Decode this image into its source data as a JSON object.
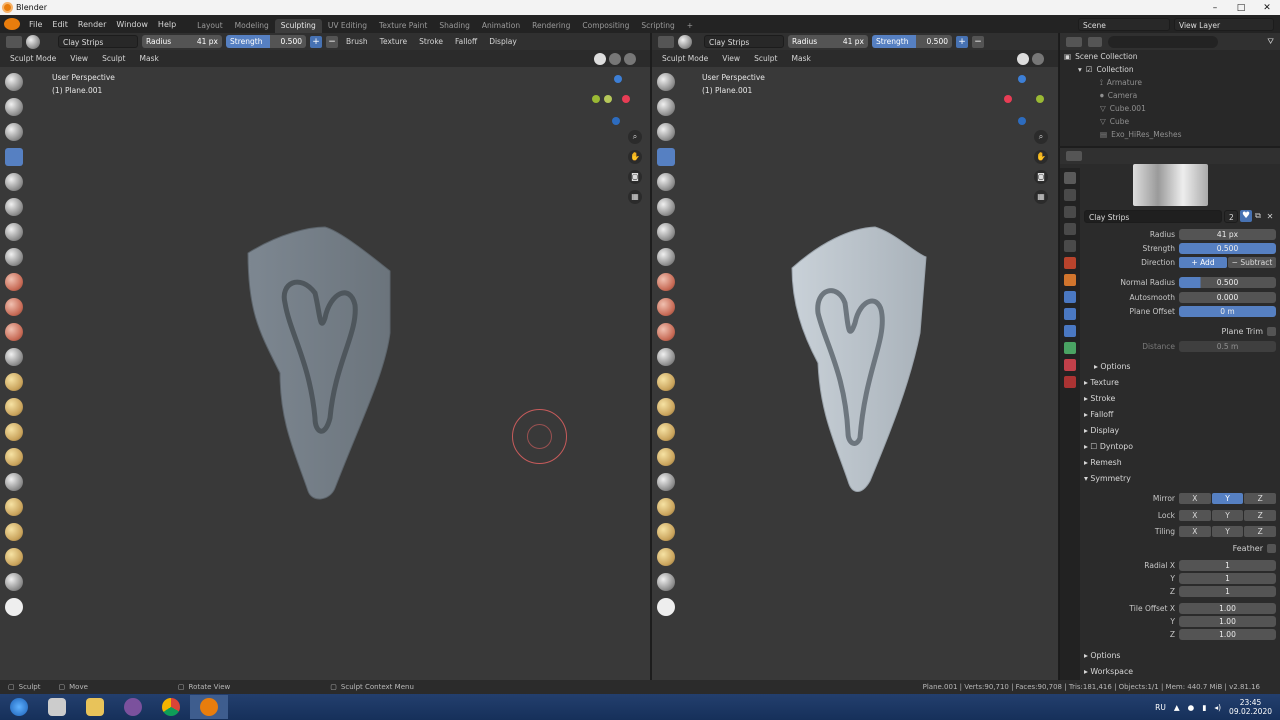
{
  "window": {
    "title": "Blender"
  },
  "menu": [
    "File",
    "Edit",
    "Render",
    "Window",
    "Help"
  ],
  "workspaces": [
    "Layout",
    "Modeling",
    "Sculpting",
    "UV Editing",
    "Texture Paint",
    "Shading",
    "Animation",
    "Rendering",
    "Compositing",
    "Scripting"
  ],
  "active_workspace": "Sculpting",
  "scene": {
    "name": "Scene",
    "view_layer": "View Layer"
  },
  "viewport_left": {
    "brush": "Clay Strips",
    "radius_label": "Radius",
    "radius_value": "41 px",
    "strength_label": "Strength",
    "strength_value": "0.500",
    "dropdowns": [
      "Brush",
      "Texture",
      "Stroke",
      "Falloff",
      "Display"
    ],
    "mode": "Sculpt Mode",
    "menus": [
      "View",
      "Sculpt",
      "Mask"
    ],
    "overlay_line1": "User Perspective",
    "overlay_line2": "(1) Plane.001"
  },
  "viewport_right": {
    "brush": "Clay Strips",
    "radius_label": "Radius",
    "radius_value": "41 px",
    "strength_label": "Strength",
    "strength_value": "0.500",
    "mode": "Sculpt Mode",
    "menus": [
      "View",
      "Sculpt",
      "Mask"
    ],
    "overlay_line1": "User Perspective",
    "overlay_line2": "(1) Plane.001"
  },
  "outliner": {
    "root": "Scene Collection",
    "collection": "Collection",
    "items": [
      "Armature",
      "Camera",
      "Cube.001",
      "Cube",
      "Exo_HiRes_Meshes"
    ]
  },
  "properties": {
    "brush_name": "Clay Strips",
    "brush_users": "2",
    "radius": {
      "label": "Radius",
      "value": "41 px"
    },
    "strength": {
      "label": "Strength",
      "value": "0.500"
    },
    "direction": {
      "label": "Direction",
      "add": "Add",
      "subtract": "Subtract"
    },
    "normal_radius": {
      "label": "Normal Radius",
      "value": "0.500"
    },
    "autosmooth": {
      "label": "Autosmooth",
      "value": "0.000"
    },
    "plane_offset": {
      "label": "Plane Offset",
      "value": "0 m"
    },
    "plane_trim": "Plane Trim",
    "distance": {
      "label": "Distance",
      "value": "0.5 m"
    },
    "options_sub": "Options",
    "panels": [
      "Texture",
      "Stroke",
      "Falloff",
      "Display",
      "Dyntopo",
      "Remesh",
      "Symmetry"
    ],
    "symmetry": {
      "mirror": "Mirror",
      "lock": "Lock",
      "tiling": "Tiling",
      "axes": [
        "X",
        "Y",
        "Z"
      ],
      "feather": "Feather",
      "radial_label": "Radial X",
      "radial": [
        "1",
        "1",
        "1"
      ],
      "tile_offset_label": "Tile Offset X",
      "tile_offset": [
        "1.00",
        "1.00",
        "1.00"
      ],
      "y_label": "Y",
      "z_label": "Z"
    },
    "bottom_panels": [
      "Options",
      "Workspace"
    ]
  },
  "statusbar": {
    "sculpt": "Sculpt",
    "move": "Move",
    "rotate": "Rotate View",
    "context": "Sculpt Context Menu",
    "info": "Plane.001 | Verts:90,710 | Faces:90,708 | Tris:181,416 | Objects:1/1 | Mem: 440.7 MiB | v2.81.16"
  },
  "taskbar": {
    "lang": "RU",
    "time": "23:45",
    "date": "09.02.2020"
  }
}
